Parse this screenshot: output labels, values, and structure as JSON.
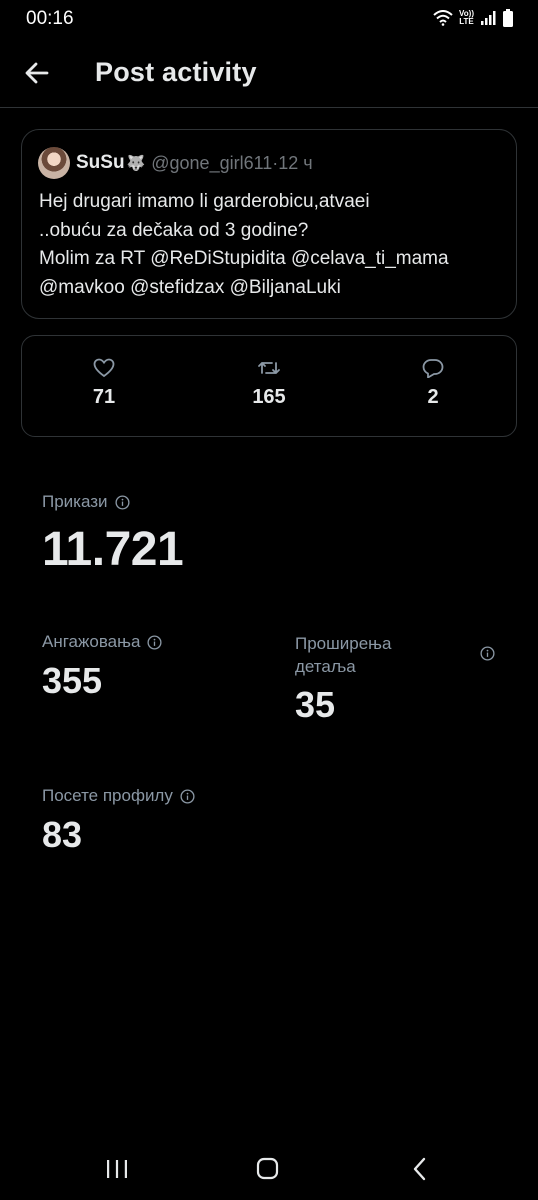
{
  "status_bar": {
    "time": "00:16",
    "lte_top": "Vo))",
    "lte_bottom": "LTE"
  },
  "header": {
    "title": "Post activity"
  },
  "post": {
    "author_name": "SuSu",
    "author_emoji": "🐺",
    "handle": "@gone_girl611",
    "separator": " · ",
    "time_ago": "12 ч",
    "lines": [
      "Hej drugari imamo li garderobicu,atvaei",
      "..obuću za dečaka od 3 godine?",
      "Molim za RT @ReDiStupidita @celava_ti_mama",
      "@mavkoo @stefidzax @BiljanaLuki"
    ]
  },
  "engagement": {
    "likes": "71",
    "reposts": "165",
    "replies": "2"
  },
  "metrics": {
    "impressions": {
      "label": "Прикази",
      "value": "11.721"
    },
    "engagements": {
      "label": "Ангажовања",
      "value": "355"
    },
    "detail_expands": {
      "label_line1": "Проширења",
      "label_line2": "детаља",
      "value": "35"
    },
    "profile_visits": {
      "label": "Посете профилу",
      "value": "83"
    }
  },
  "colors": {
    "background": "#000000",
    "text": "#e7e9ea",
    "secondary": "#71767b",
    "border": "#2f3336"
  },
  "icons": [
    "back-arrow-icon",
    "heart-icon",
    "repost-icon",
    "reply-icon",
    "info-icon",
    "recents-icon",
    "home-icon",
    "back-nav-icon"
  ]
}
